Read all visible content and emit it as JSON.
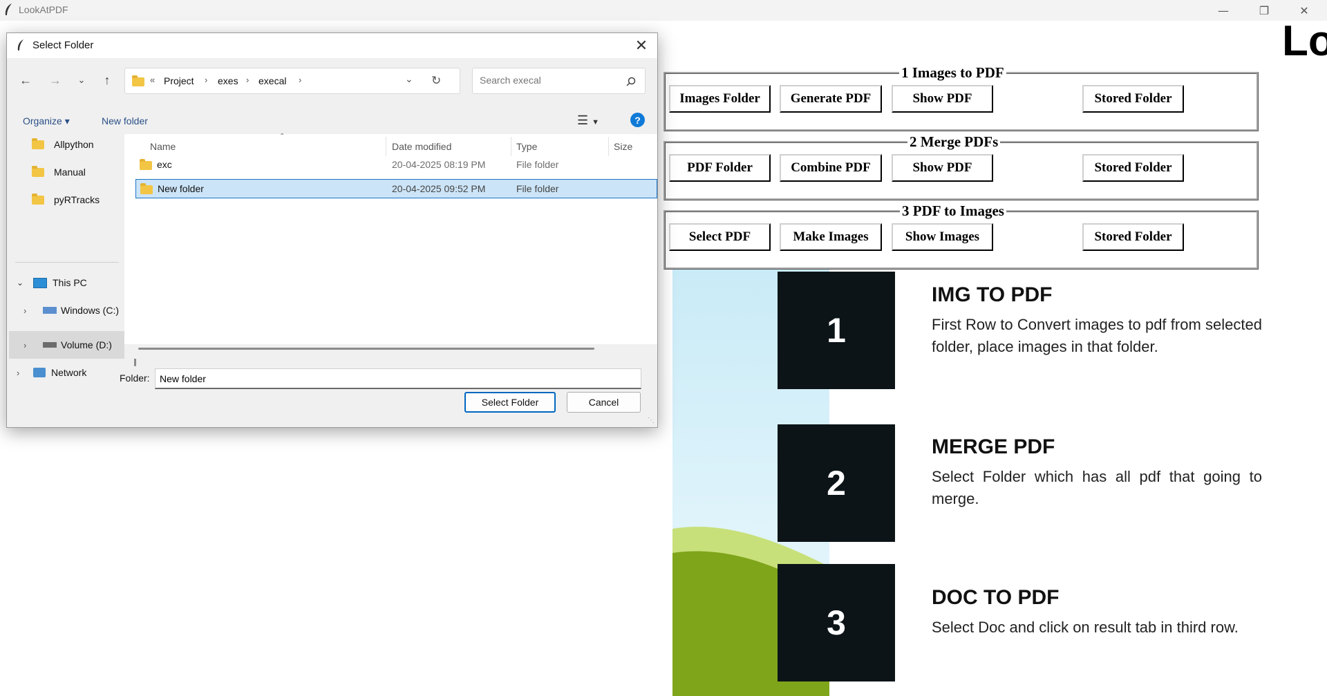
{
  "app": {
    "title": "LookAtPDF",
    "logo_text": "Lo"
  },
  "sections": [
    {
      "title": "1 Images to PDF",
      "buttons": [
        "Images Folder",
        "Generate PDF",
        "Show PDF",
        "Stored Folder"
      ]
    },
    {
      "title": "2 Merge PDFs",
      "buttons": [
        "PDF Folder",
        "Combine PDF",
        "Show PDF",
        "Stored Folder"
      ]
    },
    {
      "title": "3 PDF to Images",
      "buttons": [
        "Select PDF",
        "Make Images",
        "Show Images",
        "Stored Folder"
      ]
    }
  ],
  "info": [
    {
      "number": "1",
      "heading": "IMG TO PDF",
      "text": "First Row to Convert images to pdf from selected folder, place images in that folder."
    },
    {
      "number": "2",
      "heading": "MERGE PDF",
      "text": "Select Folder which has all pdf that going to merge."
    },
    {
      "number": "3",
      "heading": "DOC TO PDF",
      "text": "Select Doc and click on result tab in third row."
    }
  ],
  "dialog": {
    "title": "Select Folder",
    "breadcrumb": [
      "Project",
      "exes",
      "execal"
    ],
    "search_placeholder": "Search execal",
    "organize_label": "Organize",
    "new_folder_label": "New folder",
    "nav": {
      "quick": [
        "Allpython",
        "Manual",
        "pyRTracks"
      ],
      "this_pc": "This PC",
      "drives": [
        "Windows (C:)",
        "Volume (D:)"
      ],
      "network": "Network"
    },
    "columns": [
      "Name",
      "Date modified",
      "Type",
      "Size"
    ],
    "files": [
      {
        "name": "exc",
        "date": "20-04-2025 08:19 PM",
        "type": "File folder",
        "selected": false
      },
      {
        "name": "New folder",
        "date": "20-04-2025 09:52 PM",
        "type": "File folder",
        "selected": true
      }
    ],
    "folder_label": "Folder:",
    "folder_value": "New folder",
    "select_button": "Select Folder",
    "cancel_button": "Cancel"
  },
  "colors": {
    "selection": "#cce4f7",
    "selection_border": "#1a73c6",
    "accent_blue": "#0067c0",
    "number_box": "#0c1418",
    "green_dark": "#7fa51a",
    "green_light": "#c8e07a",
    "sky": "#d9f1fb"
  }
}
